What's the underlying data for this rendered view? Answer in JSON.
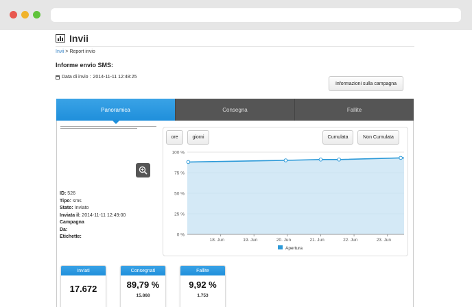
{
  "page": {
    "title": "Invii"
  },
  "breadcrumb": {
    "link": "Invii",
    "separator": " > ",
    "current": "Report invio"
  },
  "report": {
    "heading": "Informe envio SMS:",
    "date_label": "Data di invio :",
    "date_value": "2014-11-11 12:48:25",
    "info_button": "Informazioni sulla campagna"
  },
  "tabs": [
    {
      "label": "Panoramica",
      "active": true
    },
    {
      "label": "Consegna",
      "active": false
    },
    {
      "label": "Fallite",
      "active": false
    }
  ],
  "details": {
    "id_label": "ID:",
    "id_value": "526",
    "tipo_label": "Tipo:",
    "tipo_value": "sms",
    "stato_label": "Stato:",
    "stato_value": "Inviato",
    "inviata_label": "Inviata il:",
    "inviata_value": "2014-11-11 12:49:00",
    "campagna_label": "Campagna",
    "da_label": "Da:",
    "etichette_label": "Etichette:"
  },
  "chart_controls": {
    "ore": "ore",
    "giorni": "giorni",
    "cumulata": "Cumulata",
    "non_cumulata": "Non Cumulata"
  },
  "chart_data": {
    "type": "area",
    "x": [
      "17. Jun",
      "18. Jun",
      "19. Jun",
      "20. Jun",
      "21. Jun",
      "22. Jun",
      "23. Jun"
    ],
    "tick_labels_x": [
      "18. Jun",
      "19. Jun",
      "20. Jun",
      "21. Jun",
      "22. Jun",
      "23. Jun"
    ],
    "tick_labels_y": [
      "100 %",
      "75 %",
      "50 %",
      "25 %",
      "0 %"
    ],
    "ylim": [
      0,
      100
    ],
    "series": [
      {
        "name": "Apertura",
        "points": [
          {
            "x": "17.03 Jun",
            "day": 17.03,
            "y": 88
          },
          {
            "x": "19.95 Jun",
            "day": 19.95,
            "y": 90
          },
          {
            "x": "21.0 Jun",
            "day": 21.0,
            "y": 91
          },
          {
            "x": "21.55 Jun",
            "day": 21.55,
            "y": 91
          },
          {
            "x": "23.4 Jun",
            "day": 23.4,
            "y": 93
          }
        ],
        "color": "#2d9ad8",
        "fill": "#d4e9f6"
      }
    ],
    "grid": true,
    "legend": "bottom-center"
  },
  "stats": [
    {
      "title": "Inviati",
      "value": "17.672",
      "sub": ""
    },
    {
      "title": "Consegnati",
      "value": "89,79 %",
      "sub": "15.868"
    },
    {
      "title": "Fallite",
      "value": "9,92 %",
      "sub": "1.753"
    }
  ],
  "colors": {
    "accent": "#2d9ad8",
    "tab_dark": "#555555"
  }
}
